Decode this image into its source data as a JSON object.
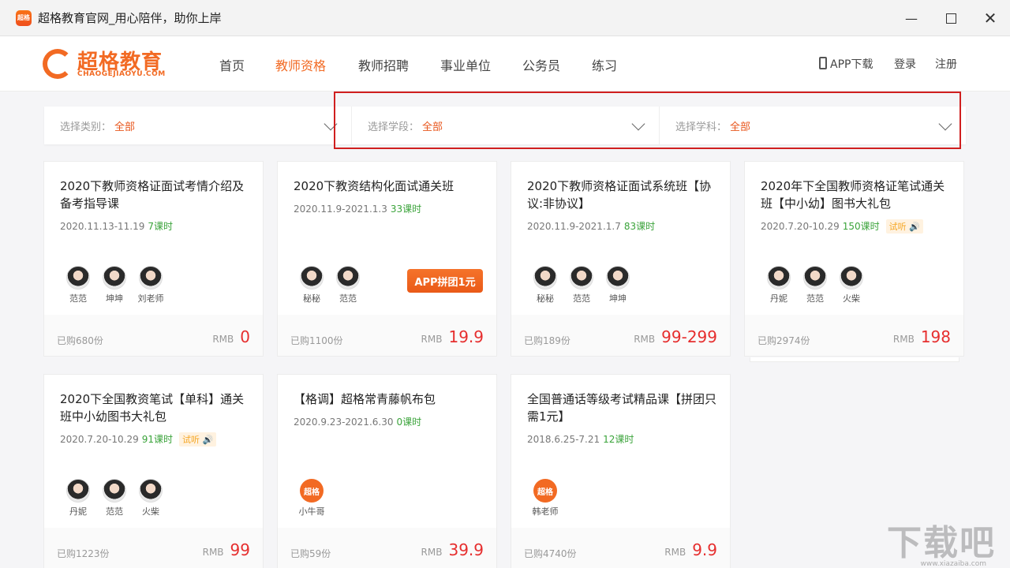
{
  "window": {
    "title": "超格教育官网_用心陪伴，助你上岸",
    "icon_text": "超格",
    "controls": [
      "minimize-icon",
      "maximize-icon",
      "close-icon"
    ]
  },
  "brand": {
    "name_cn": "超格教育",
    "name_en": "CHAOGEJIAOYU.COM",
    "color": "#f26a23"
  },
  "nav": {
    "items": [
      "首页",
      "教师资格",
      "教师招聘",
      "事业单位",
      "公务员",
      "练习"
    ],
    "active_index": 1,
    "app_download": "APP下载",
    "login": "登录",
    "register": "注册"
  },
  "filters": [
    {
      "label": "选择类别：",
      "value": "全部"
    },
    {
      "label": "选择学段：",
      "value": "全部"
    },
    {
      "label": "选择学科：",
      "value": "全部"
    }
  ],
  "cards": [
    {
      "title": "2020下教师资格证面试考情介绍及备考指导课",
      "date": "2020.11.13-11.19",
      "lessons": "7课时",
      "trial": "",
      "teachers": [
        "范范",
        "坤坤",
        "刘老师"
      ],
      "promo": "",
      "sold": "已购680份",
      "rmb": "RMB",
      "price": "0"
    },
    {
      "title": "2020下教资结构化面试通关班",
      "date": "2020.11.9-2021.1.3",
      "lessons": "33课时",
      "trial": "",
      "teachers": [
        "秘秘",
        "范范"
      ],
      "promo": "APP拼团1元",
      "sold": "已购1100份",
      "rmb": "RMB",
      "price": "19.9"
    },
    {
      "title": "2020下教师资格证面试系统班【协议:非协议】",
      "date": "2020.11.9-2021.1.7",
      "lessons": "83课时",
      "trial": "",
      "teachers": [
        "秘秘",
        "范范",
        "坤坤"
      ],
      "promo": "",
      "sold": "已购189份",
      "rmb": "RMB",
      "price": "99-299"
    },
    {
      "title": "2020年下全国教师资格证笔试通关班【中小幼】图书大礼包",
      "date": "2020.7.20-10.29",
      "lessons": "150课时",
      "trial": "试听",
      "teachers": [
        "丹妮",
        "范范",
        "火柴"
      ],
      "promo": "",
      "sold": "已购2974份",
      "rmb": "RMB",
      "price": "198"
    },
    {
      "title": "2020下全国教资笔试【单科】通关班中小幼图书大礼包",
      "date": "2020.7.20-10.29",
      "lessons": "91课时",
      "trial": "试听",
      "teachers": [
        "丹妮",
        "范范",
        "火柴"
      ],
      "promo": "",
      "sold": "已购1223份",
      "rmb": "RMB",
      "price": "99"
    },
    {
      "title": "【格调】超格常青藤帆布包",
      "date": "2020.9.23-2021.6.30",
      "lessons": "0课时",
      "trial": "",
      "teachers": [
        "小牛哥"
      ],
      "promo": "",
      "sold": "已购59份",
      "rmb": "RMB",
      "price": "39.9"
    },
    {
      "title": "全国普通话等级考试精品课【拼团只需1元】",
      "date": "2018.6.25-7.21",
      "lessons": "12课时",
      "trial": "",
      "teachers": [
        "韩老师"
      ],
      "promo": "",
      "sold": "已购4740份",
      "rmb": "RMB",
      "price": "9.9"
    }
  ],
  "brand_avatar_text": "超格",
  "watermark": "下载吧",
  "watermark_sub": "www.xiazaiba.com"
}
